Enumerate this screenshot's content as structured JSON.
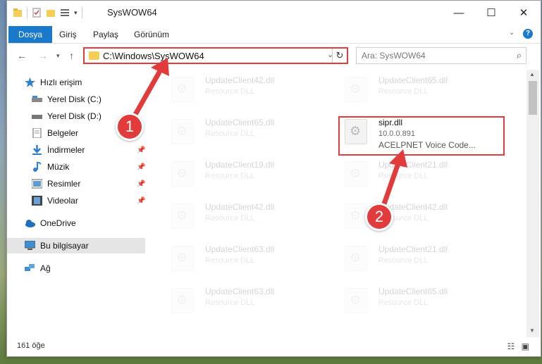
{
  "window": {
    "title": "SysWOW64"
  },
  "ribbon": {
    "tabs": [
      "Dosya",
      "Giriş",
      "Paylaş",
      "Görünüm"
    ]
  },
  "address": {
    "path": "C:\\Windows\\SysWOW64"
  },
  "search": {
    "placeholder": "Ara: SysWOW64"
  },
  "sidebar": {
    "items": [
      {
        "label": "Hızlı erişim",
        "icon": "star-icon"
      },
      {
        "label": "Yerel Disk (C:)",
        "icon": "drive-icon"
      },
      {
        "label": "Yerel Disk (D:)",
        "icon": "drive-icon"
      },
      {
        "label": "Belgeler",
        "icon": "document-icon"
      },
      {
        "label": "İndirmeler",
        "icon": "download-icon"
      },
      {
        "label": "Müzik",
        "icon": "music-icon"
      },
      {
        "label": "Resimler",
        "icon": "pictures-icon"
      },
      {
        "label": "Videolar",
        "icon": "video-icon"
      },
      {
        "label": "OneDrive",
        "icon": "cloud-icon"
      },
      {
        "label": "Bu bilgisayar",
        "icon": "computer-icon"
      },
      {
        "label": "Ağ",
        "icon": "network-icon"
      }
    ]
  },
  "files": [
    {
      "name": "UpdateClient42.dll",
      "desc": "Resource DLL"
    },
    {
      "name": "UpdateClient65.dll",
      "desc": "Resource DLL"
    },
    {
      "name": "UpdateClient65.dll",
      "desc": "Resource DLL"
    },
    {
      "name": "sipr.dll",
      "version": "10.0.0.891",
      "desc": "ACELPNET Voice Code..."
    },
    {
      "name": "UpdateClient19.dll",
      "desc": "Resource DLL"
    },
    {
      "name": "UpdateClient21.dll",
      "desc": "Resource DLL"
    },
    {
      "name": "UpdateClient42.dll",
      "desc": "Resource DLL"
    },
    {
      "name": "UpdateClient42.dll",
      "desc": "Resource DLL"
    },
    {
      "name": "UpdateClient63.dll",
      "desc": "Resource DLL"
    },
    {
      "name": "UpdateClient21.dll",
      "desc": "Resource DLL"
    },
    {
      "name": "UpdateClient63.dll",
      "desc": "Resource DLL"
    },
    {
      "name": "UpdateClient65.dll",
      "desc": "Resource DLL"
    }
  ],
  "status": {
    "count": "161 öğe"
  },
  "callouts": [
    "1",
    "2"
  ],
  "colors": {
    "accent": "#1979ca",
    "highlight": "#e13b3b"
  }
}
